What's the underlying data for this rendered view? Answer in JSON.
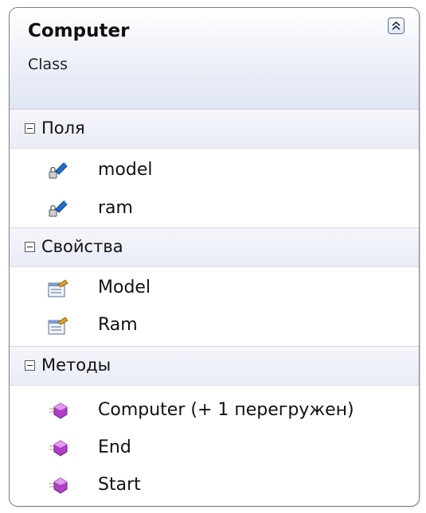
{
  "class": {
    "name": "Computer",
    "stereotype": "Class"
  },
  "sections": {
    "fields": {
      "label": "Поля",
      "items": [
        "model",
        "ram"
      ]
    },
    "properties": {
      "label": "Свойства",
      "items": [
        "Model",
        "Ram"
      ]
    },
    "methods": {
      "label": "Методы",
      "items": [
        "Computer (+ 1 перегружен)",
        "End",
        "Start"
      ]
    }
  },
  "icons": {
    "collapse": "double-chevron-up-icon",
    "field": "private-field-icon",
    "property": "property-icon",
    "method": "method-icon"
  },
  "colors": {
    "field_accent": "#1f6fd1",
    "method_accent": "#b03ec7",
    "property_accent": "#e0a020"
  }
}
